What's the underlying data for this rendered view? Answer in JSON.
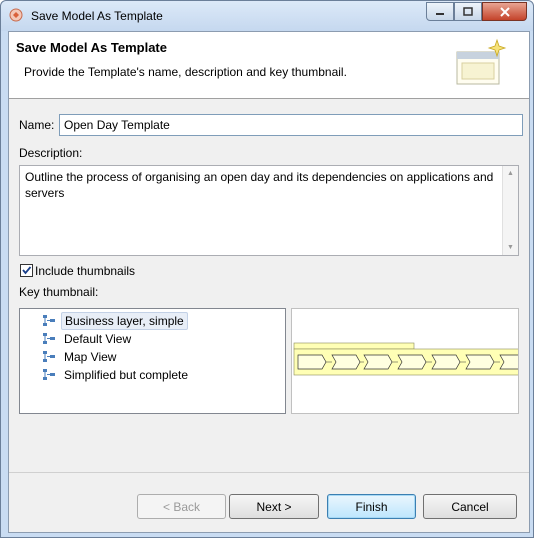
{
  "window": {
    "title": "Save Model As Template"
  },
  "header": {
    "title": "Save Model As Template",
    "description": "Provide the Template's name, description and key thumbnail."
  },
  "form": {
    "name_label": "Name:",
    "name_value": "Open Day Template",
    "description_label": "Description:",
    "description_value": "Outline the process of organising an open day and its dependencies on applications and servers",
    "include_thumbnails_label": "Include thumbnails",
    "include_thumbnails_checked": true,
    "key_thumbnail_label": "Key thumbnail:"
  },
  "thumbnails": [
    {
      "label": "Business layer, simple",
      "selected": true
    },
    {
      "label": "Default View",
      "selected": false
    },
    {
      "label": "Map View",
      "selected": false
    },
    {
      "label": "Simplified but complete",
      "selected": false
    }
  ],
  "buttons": {
    "back": "< Back",
    "next": "Next >",
    "finish": "Finish",
    "cancel": "Cancel"
  },
  "colors": {
    "process_fill": "#ffffb5",
    "selection": "#e8eef7",
    "default_button": "#bee6fd"
  }
}
